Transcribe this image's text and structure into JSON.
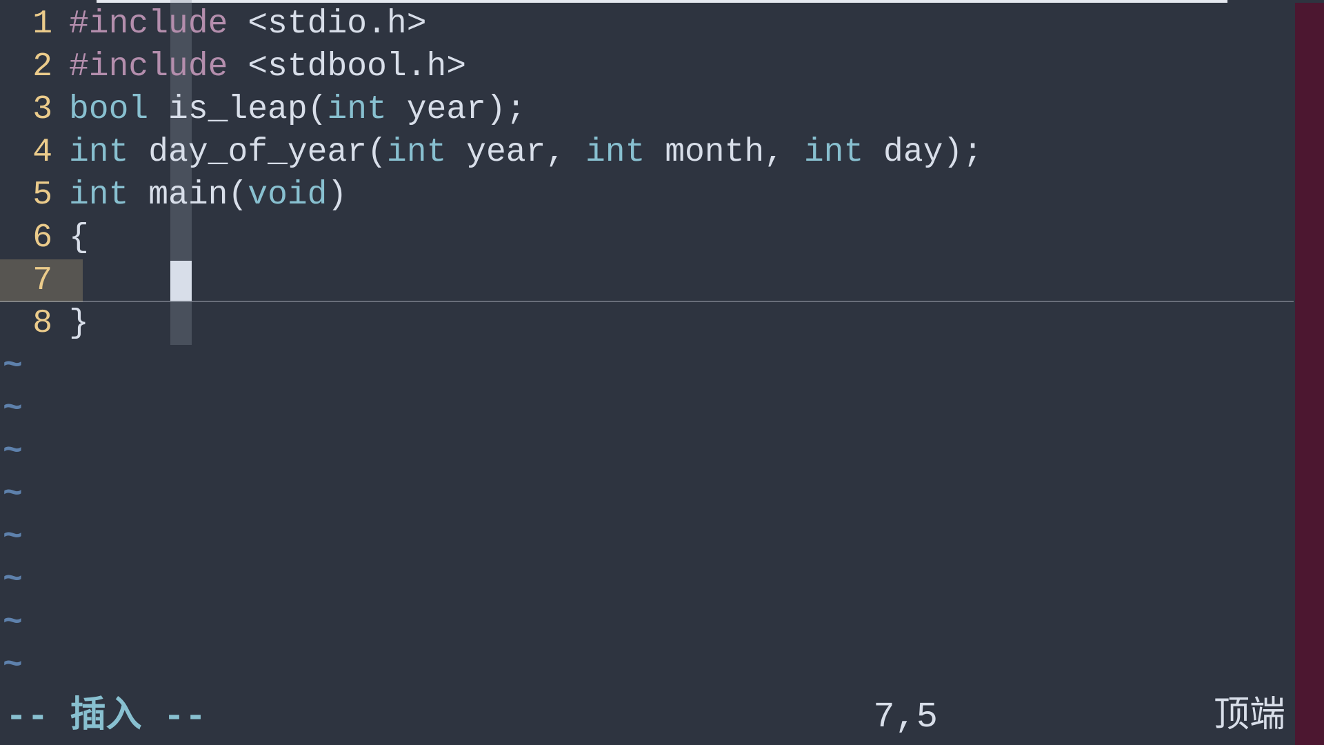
{
  "lines": [
    {
      "num": "1",
      "tokens": [
        {
          "cls": "preprocessor",
          "t": "#include "
        },
        {
          "cls": "include-path",
          "t": "<stdio.h>"
        }
      ]
    },
    {
      "num": "2",
      "tokens": [
        {
          "cls": "preprocessor",
          "t": "#include "
        },
        {
          "cls": "include-path",
          "t": "<stdbool.h>"
        }
      ]
    },
    {
      "num": "3",
      "tokens": [
        {
          "cls": "type",
          "t": "bool"
        },
        {
          "cls": "punct",
          "t": " "
        },
        {
          "cls": "func",
          "t": "is_leap"
        },
        {
          "cls": "punct",
          "t": "("
        },
        {
          "cls": "type",
          "t": "int"
        },
        {
          "cls": "punct",
          "t": " year);"
        }
      ]
    },
    {
      "num": "4",
      "tokens": [
        {
          "cls": "type",
          "t": "int"
        },
        {
          "cls": "punct",
          "t": " "
        },
        {
          "cls": "func",
          "t": "day_of_year"
        },
        {
          "cls": "punct",
          "t": "("
        },
        {
          "cls": "type",
          "t": "int"
        },
        {
          "cls": "punct",
          "t": " year, "
        },
        {
          "cls": "type",
          "t": "int"
        },
        {
          "cls": "punct",
          "t": " month, "
        },
        {
          "cls": "type",
          "t": "int"
        },
        {
          "cls": "punct",
          "t": " day);"
        }
      ]
    },
    {
      "num": "5",
      "tokens": [
        {
          "cls": "type",
          "t": "int"
        },
        {
          "cls": "punct",
          "t": " "
        },
        {
          "cls": "func",
          "t": "main"
        },
        {
          "cls": "punct",
          "t": "("
        },
        {
          "cls": "type",
          "t": "void"
        },
        {
          "cls": "punct",
          "t": ")"
        }
      ]
    },
    {
      "num": "6",
      "tokens": [
        {
          "cls": "punct",
          "t": "{"
        }
      ]
    },
    {
      "num": "7",
      "tokens": [
        {
          "cls": "punct",
          "t": "    "
        }
      ]
    },
    {
      "num": "8",
      "tokens": [
        {
          "cls": "punct",
          "t": "}"
        }
      ]
    }
  ],
  "tilde": "~",
  "tilde_count": 8,
  "status": {
    "mode": "-- 插入 --",
    "cursor": "7,5",
    "scroll": "顶端"
  }
}
